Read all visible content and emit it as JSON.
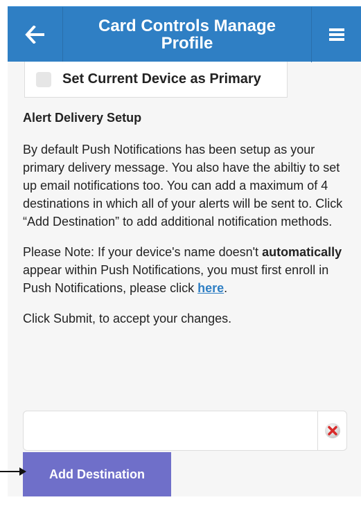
{
  "header": {
    "title_line1": "Card Controls Manage",
    "title_line2": "Profile",
    "back_icon": "arrow-left-icon",
    "menu_icon": "hamburger-menu-icon",
    "color": "#2f7fc4"
  },
  "device": {
    "checkbox_label": "Set Current Device as Primary",
    "checked": false
  },
  "alert": {
    "title": "Alert Delivery Setup",
    "description": "By default Push Notifications has been setup as your primary delivery message. You also have the abiltiy to set up email notifications too. You can add a maximum of 4 destinations in which all of your alerts will be sent to. Click “Add Destination” to add additional notification methods.",
    "note_prefix": "Please Note: If your device's name doesn't ",
    "note_bold": "automatically",
    "note_middle": " appear within Push Notifications, you must first enroll in Push Notifications, please click ",
    "note_link": "here",
    "note_suffix": ".",
    "submit_hint": "Click Submit, to accept your changes."
  },
  "destination": {
    "value": "",
    "placeholder": "",
    "clear_icon": "remove-x-icon"
  },
  "add_destination_label": "Add Destination",
  "colors": {
    "accent": "#2f7fc4",
    "add_button": "#6f6fc9",
    "clear_red": "#d92b2b"
  }
}
